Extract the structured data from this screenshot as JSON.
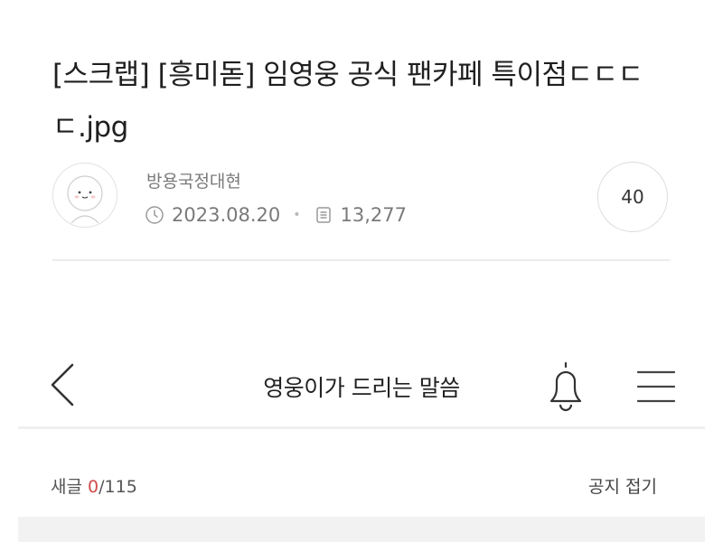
{
  "post": {
    "title": "[스크랩] [흥미돋] 임영웅 공식 팬카페 특이점ㄷㄷㄷㄷ.jpg",
    "author": "방용국정대현",
    "date": "2023.08.20",
    "views": "13,277",
    "comment_count": "40"
  },
  "cafe": {
    "title": "영웅이가 드리는 말씀",
    "post_count_label": "새글",
    "post_count_current": "0",
    "post_count_total": "/115",
    "notice_toggle": "공지 접기"
  },
  "icons": {
    "back": "chevron-left-icon",
    "bell": "bell-icon",
    "menu": "hamburger-menu-icon",
    "clock": "clock-icon",
    "views": "document-icon"
  },
  "colors": {
    "new_count": "#d14b4b",
    "meta_text": "#7a7a7a",
    "divider": "#ececec"
  }
}
